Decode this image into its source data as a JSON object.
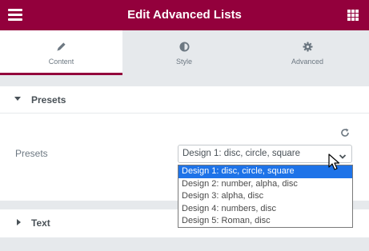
{
  "header": {
    "title": "Edit Advanced Lists",
    "menu_icon": "hamburger-menu-icon",
    "apps_icon": "grid-apps-icon",
    "background": "#93003c"
  },
  "tabs": [
    {
      "label": "Content",
      "icon": "pencil-icon",
      "active": true
    },
    {
      "label": "Style",
      "icon": "half-circle-icon",
      "active": false
    },
    {
      "label": "Advanced",
      "icon": "gear-icon",
      "active": false
    }
  ],
  "presets_section": {
    "title": "Presets",
    "expanded": true,
    "control_label": "Presets",
    "reset_icon": "refresh-icon",
    "select_value": "Design 1: disc, circle, square",
    "options": [
      "Design 1: disc, circle, square",
      "Design 2: number, alpha, disc",
      "Design 3: alpha, disc",
      "Design 4: numbers, disc",
      "Design 5: Roman, disc"
    ],
    "highlighted_option_index": 0
  },
  "text_section": {
    "title": "Text",
    "expanded": false
  },
  "colors": {
    "accent": "#93003c",
    "selection": "#1e73e8",
    "panel_bg": "#e6e9ec"
  }
}
